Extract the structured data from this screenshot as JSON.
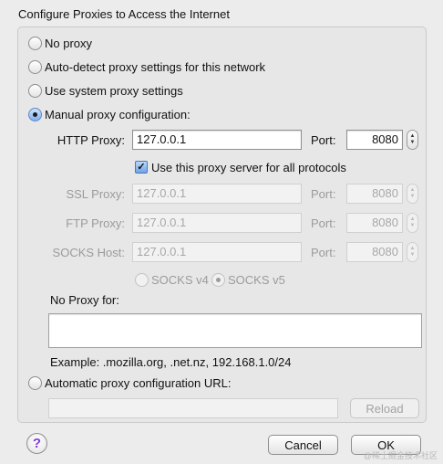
{
  "dialog": {
    "title": "Configure Proxies to Access the Internet"
  },
  "options": {
    "no_proxy": "No proxy",
    "auto_detect": "Auto-detect proxy settings for this network",
    "system": "Use system proxy settings",
    "manual": "Manual proxy configuration:",
    "auto_url": "Automatic proxy configuration URL:",
    "selected": "manual"
  },
  "manual": {
    "port_label": "Port:",
    "http": {
      "label": "HTTP Proxy:",
      "host": "127.0.0.1",
      "port": "8080"
    },
    "use_for_all": {
      "label": "Use this proxy server for all protocols",
      "checked": true
    },
    "ssl": {
      "label": "SSL Proxy:",
      "host": "127.0.0.1",
      "port": "8080"
    },
    "ftp": {
      "label": "FTP Proxy:",
      "host": "127.0.0.1",
      "port": "8080"
    },
    "socks": {
      "label": "SOCKS Host:",
      "host": "127.0.0.1",
      "port": "8080"
    },
    "socks_v4": "SOCKS v4",
    "socks_v5": "SOCKS v5",
    "socks_selected": "v5"
  },
  "no_proxy": {
    "label": "No Proxy for:",
    "value": "",
    "example": "Example: .mozilla.org, .net.nz, 192.168.1.0/24"
  },
  "auto_url": {
    "value": "",
    "reload_label": "Reload"
  },
  "footer": {
    "help_glyph": "?",
    "cancel_label": "Cancel",
    "ok_label": "OK",
    "watermark": "@稀土掘金技术社区"
  },
  "icons": {
    "help": "help-icon",
    "stepper_up": "chevron-up-icon",
    "stepper_down": "chevron-down-icon",
    "checkmark": "checkmark-icon"
  },
  "colors": {
    "window_bg": "#ececec",
    "radio_selected": "#7fb0ee",
    "help_glyph": "#7d3fd8"
  }
}
